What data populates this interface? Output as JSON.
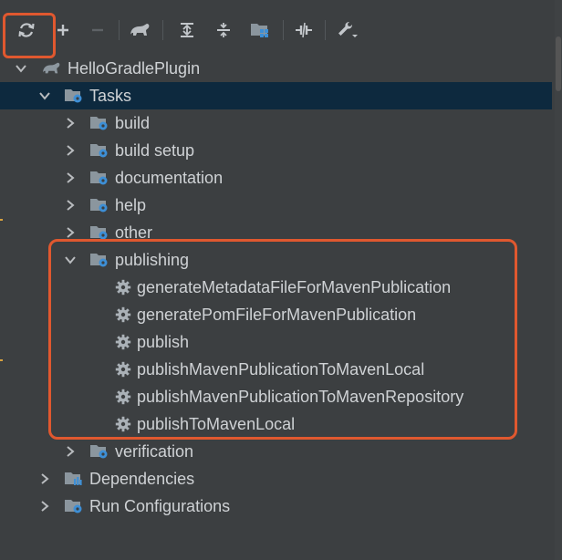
{
  "toolbar": {
    "buttons": [
      "refresh",
      "add",
      "remove",
      "gradle",
      "expand-all",
      "collapse-all",
      "group-modules",
      "toggle-offline",
      "build-tool-settings"
    ]
  },
  "tree": {
    "project": "HelloGradlePlugin",
    "tasks_label": "Tasks",
    "groups": [
      "build",
      "build setup",
      "documentation",
      "help",
      "other",
      "publishing",
      "verification"
    ],
    "publishing_tasks": [
      "generateMetadataFileForMavenPublication",
      "generatePomFileForMavenPublication",
      "publish",
      "publishMavenPublicationToMavenLocal",
      "publishMavenPublicationToMavenRepository",
      "publishToMavenLocal"
    ],
    "dependencies_label": "Dependencies",
    "run_configurations_label": "Run Configurations"
  },
  "colors": {
    "background": "#3c3f41",
    "selection": "#0d293e",
    "highlight_border": "#e0582f",
    "folder_icon": "#7f8b93",
    "gear_blue": "#3d8fd6"
  }
}
